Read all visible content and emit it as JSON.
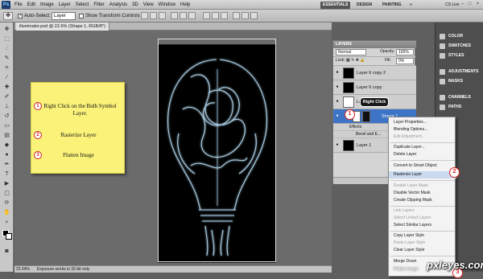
{
  "menubar": {
    "ps_logo": "Ps",
    "items": [
      "File",
      "Edit",
      "Image",
      "Layer",
      "Select",
      "Filter",
      "Analysis",
      "3D",
      "View",
      "Window",
      "Help"
    ],
    "workspaces": [
      "ESSENTIALS",
      "DESIGN",
      "PAINTING",
      "»"
    ],
    "cs_live": "CS Live"
  },
  "options": {
    "auto_select_label": "Auto-Select:",
    "auto_select_value": "Layer",
    "transform_label": "Show Transform Controls"
  },
  "document": {
    "tab_title": "illuminator.psd @ 22.6% (Shape 1, RGB/8*)"
  },
  "status": {
    "zoom": "22.64%",
    "message": "Exposure works in 32-bit only"
  },
  "notes": {
    "step1_num": "1",
    "step1": "Right Click on the Bulb Symbol Layer.",
    "step2_num": "2",
    "step2": "Rasterize Layer",
    "step3_num": "3",
    "step3": "Flatten Image"
  },
  "layers_panel": {
    "title": "LAYERS",
    "blend_mode": "Normal",
    "opacity_label": "Opacity:",
    "opacity_value": "100%",
    "lock_label": "Lock:",
    "fill_label": "Fill:",
    "fill_value": "0%",
    "layers": [
      {
        "name": "Layer 6 copy 2"
      },
      {
        "name": "Layer 6 copy"
      },
      {
        "name": "Lay..."
      },
      {
        "name": "Shape 1"
      },
      {
        "name": "Layer 1"
      }
    ],
    "effects_label": "Effects",
    "bevel_label": "Bevel and E..."
  },
  "tooltip": "Right Click",
  "callout_1": "1",
  "callout_2": "2",
  "callout_3": "3",
  "dock": {
    "items": [
      "COLOR",
      "SWATCHES",
      "STYLES",
      "ADJUSTMENTS",
      "MASKS",
      "CHANNELS",
      "PATHS"
    ]
  },
  "context_menu": {
    "items": [
      {
        "label": "Layer Properties...",
        "disabled": false
      },
      {
        "label": "Blending Options...",
        "disabled": false
      },
      {
        "label": "Edit Adjustment...",
        "disabled": true
      },
      {
        "label": "Duplicate Layer...",
        "disabled": false
      },
      {
        "label": "Delete Layer",
        "disabled": false
      },
      {
        "label": "Convert to Smart Object",
        "disabled": false
      },
      {
        "label": "Rasterize Layer",
        "disabled": false
      },
      {
        "label": "Enable Layer Mask",
        "disabled": true
      },
      {
        "label": "Disable Vector Mask",
        "disabled": false
      },
      {
        "label": "Create Clipping Mask",
        "disabled": false
      },
      {
        "label": "Link Layers",
        "disabled": true
      },
      {
        "label": "Select Linked Layers",
        "disabled": true
      },
      {
        "label": "Select Similar Layers",
        "disabled": false
      },
      {
        "label": "Copy Layer Style",
        "disabled": false
      },
      {
        "label": "Paste Layer Style",
        "disabled": true
      },
      {
        "label": "Clear Layer Style",
        "disabled": false
      },
      {
        "label": "Merge Down",
        "disabled": false
      },
      {
        "label": "Flatten Image",
        "disabled": false
      }
    ]
  },
  "watermark": "pxleyes.com",
  "colors": {
    "note_yellow": "#fbf27a",
    "callout_red": "#d22222",
    "selected_layer": "#3d74c6",
    "glow": "#bfe6ff"
  }
}
